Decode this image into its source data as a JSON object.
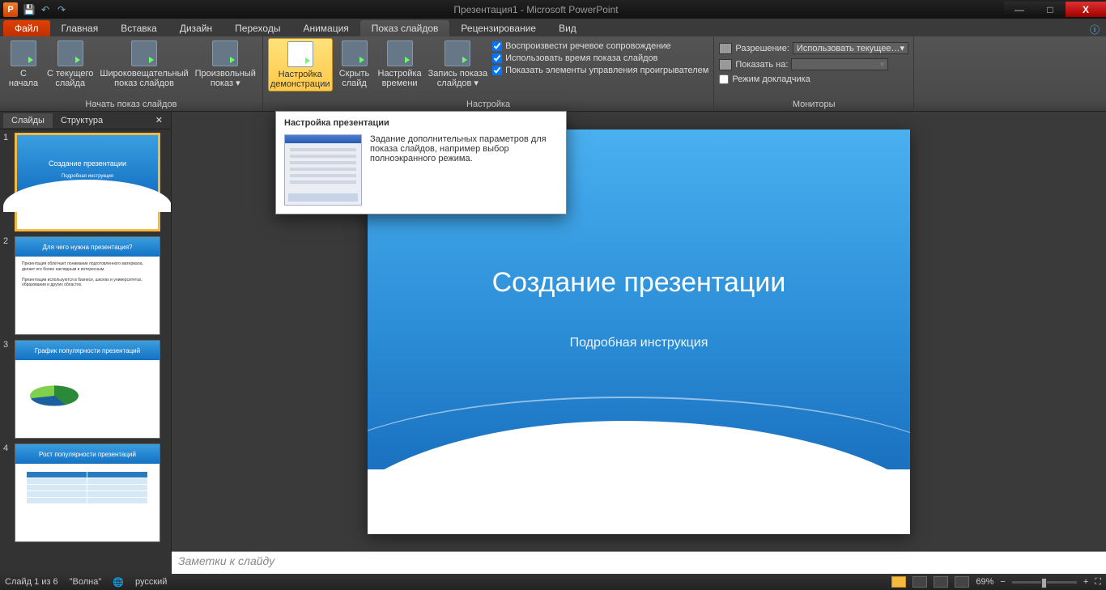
{
  "window": {
    "title": "Презентация1 - Microsoft PowerPoint",
    "app_badge": "P"
  },
  "qat": {
    "save": "💾",
    "undo": "↶",
    "redo": "↷"
  },
  "tabs": {
    "file": "Файл",
    "items": [
      "Главная",
      "Вставка",
      "Дизайн",
      "Переходы",
      "Анимация",
      "Показ слайдов",
      "Рецензирование",
      "Вид"
    ],
    "active_index": 5
  },
  "ribbon": {
    "group_start": {
      "label": "Начать показ слайдов",
      "btn_from_start": "С\nначала",
      "btn_from_current": "С текущего\nслайда",
      "btn_broadcast": "Широковещательный\nпоказ слайдов",
      "btn_custom": "Произвольный\nпоказ ▾"
    },
    "group_setup": {
      "label": "Настройка",
      "btn_setup": "Настройка\nдемонстрации",
      "btn_hide": "Скрыть\nслайд",
      "btn_rehearse": "Настройка\nвремени",
      "btn_record": "Запись показа\nслайдов ▾",
      "chk_narration": "Воспроизвести речевое сопровождение",
      "chk_timings": "Использовать время показа слайдов",
      "chk_controls": "Показать элементы управления проигрывателем"
    },
    "group_monitors": {
      "label": "Мониторы",
      "resolution_lbl": "Разрешение:",
      "resolution_val": "Использовать текущее…",
      "showon_lbl": "Показать на:",
      "presenter": "Режим докладчика"
    }
  },
  "tooltip": {
    "title": "Настройка презентации",
    "body": "Задание дополнительных параметров для показа слайдов, например выбор полноэкранного режима."
  },
  "panel": {
    "tab_slides": "Слайды",
    "tab_outline": "Структура",
    "thumbs": [
      {
        "n": "1",
        "title": "Создание презентации",
        "sub": "Подробная инструкция"
      },
      {
        "n": "2",
        "head": "Для чего нужна презентация?",
        "body": "Презентация облегчает понимание…\nПрезентация…"
      },
      {
        "n": "3",
        "head": "График популярности презентаций"
      },
      {
        "n": "4",
        "head": "Рост популярности презентаций"
      }
    ]
  },
  "slide": {
    "title": "Создание презентации",
    "subtitle": "Подробная инструкция"
  },
  "notes_placeholder": "Заметки к слайду",
  "status": {
    "slide_counter": "Слайд 1 из 6",
    "theme": "\"Волна\"",
    "language": "русский",
    "zoom": "69%"
  }
}
